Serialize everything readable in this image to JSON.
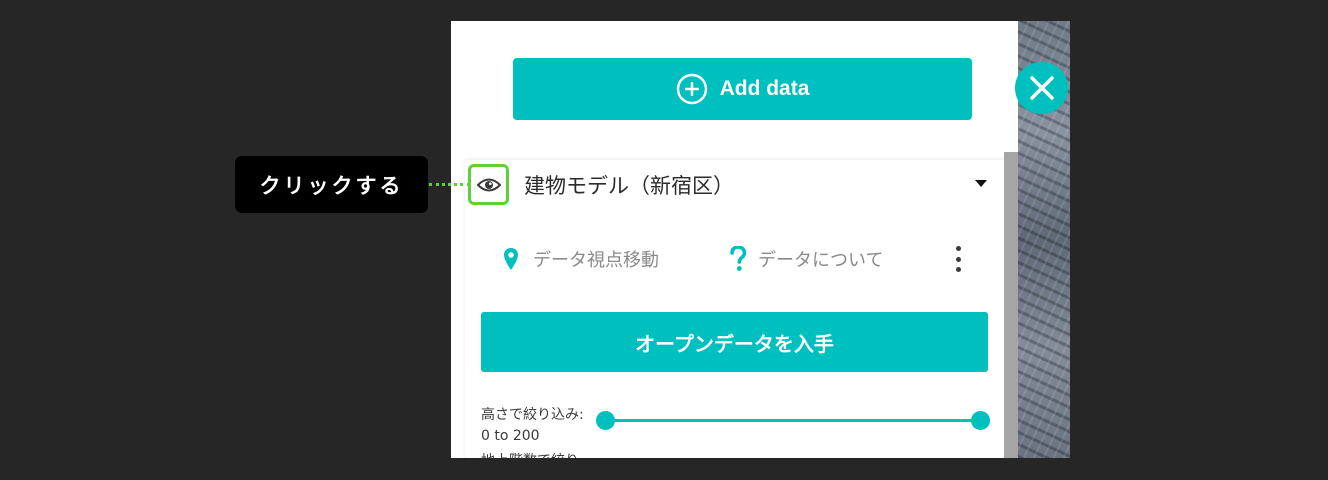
{
  "add_data": {
    "label": "Add data",
    "icon": "plus-circle-icon"
  },
  "close": {
    "icon": "close-icon"
  },
  "layer": {
    "title": "建物モデル（新宿区）",
    "visibility_icon": "eye-icon",
    "expand_icon": "caret-down-icon",
    "actions": {
      "zoom_label": "データ視点移動",
      "zoom_icon": "map-pin-icon",
      "about_label": "データについて",
      "about_icon": "question-icon",
      "more_icon": "kebab-icon"
    },
    "opendata_label": "オープンデータを入手",
    "height_filter": {
      "label": "高さで絞り込み:",
      "range_text": "0 to 200",
      "min": 0,
      "max": 200,
      "value_low": 0,
      "value_high": 200,
      "next_label": "地上階数で絞り"
    }
  },
  "callout": {
    "text": "クリックする"
  },
  "colors": {
    "accent": "#00bfbf",
    "highlight": "#5fcf3c",
    "background": "#262626"
  }
}
